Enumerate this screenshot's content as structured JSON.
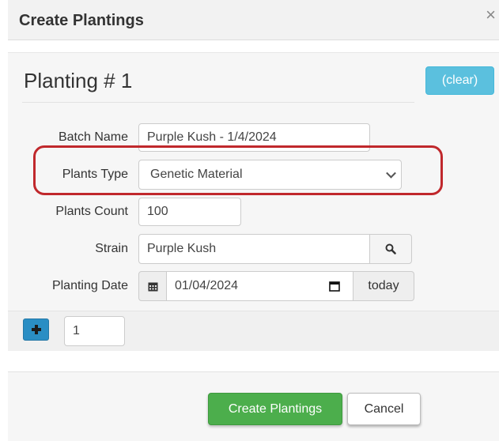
{
  "dialog": {
    "title": "Create Plantings",
    "close_symbol": "×"
  },
  "planting": {
    "heading": "Planting # 1",
    "clear_label": "(clear)"
  },
  "form": {
    "batch_name": {
      "label": "Batch Name",
      "value": "Purple Kush - 1/4/2024"
    },
    "plants_type": {
      "label": "Plants Type",
      "value": "Genetic Material"
    },
    "plants_count": {
      "label": "Plants Count",
      "value": "100"
    },
    "strain": {
      "label": "Strain",
      "value": "Purple Kush",
      "search_icon": "search-icon"
    },
    "planting_date": {
      "label": "Planting Date",
      "value": "01/04/2024",
      "today_label": "today",
      "calendar_icon": "calendar-icon"
    }
  },
  "add_row": {
    "count_value": "1"
  },
  "footer": {
    "create_label": "Create Plantings",
    "cancel_label": "Cancel"
  },
  "colors": {
    "clear_button": "#5bc0de",
    "create_button": "#4cae4c",
    "add_button": "#2a8ec4",
    "highlight": "#c0282c"
  }
}
